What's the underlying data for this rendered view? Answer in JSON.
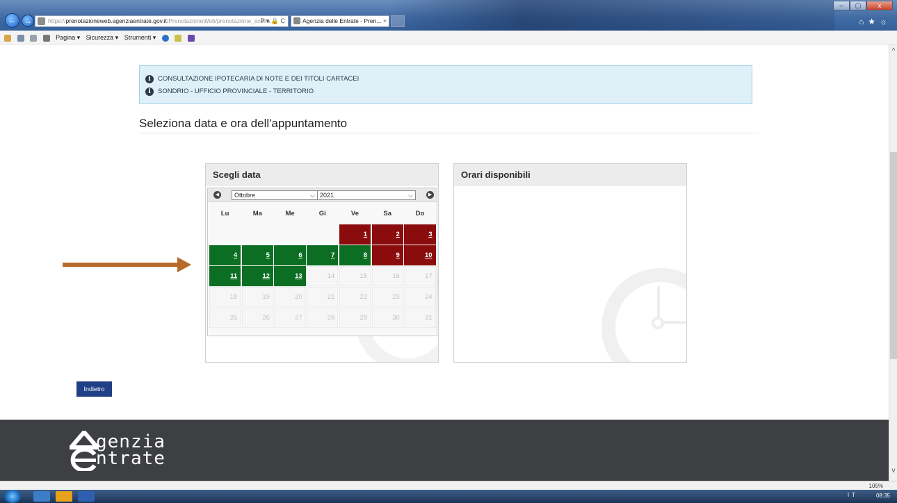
{
  "browser": {
    "address_prefix": "https://",
    "address_host": "prenotazioneweb.agenziaentrate.gov.it",
    "address_path": "/PrenotazioneWeb/prenotazione_scelta...",
    "address_controls": "P ▾ 🔒 C",
    "tab_title": "Agenzia delle Entrate - Pren...",
    "tab_close": "×",
    "commands": [
      "Pagina ▾",
      "Sicurezza ▾",
      "Strumenti ▾"
    ],
    "zoom": "105%",
    "window_controls": [
      "–",
      "▢",
      "x"
    ],
    "right_icons": "⌂★☼"
  },
  "info": {
    "lines": [
      "CONSULTAZIONE IPOTECARIA DI NOTE E DEI TITOLI CARTACEI",
      "SONDRIO - UFFICIO PROVINCIALE - TERRITORIO"
    ]
  },
  "page": {
    "title": "Seleziona data e ora dell'appuntamento",
    "back_label": "Indietro"
  },
  "date_panel": {
    "title": "Scegli data",
    "month": "Ottobre",
    "year": "2021",
    "weekdays": [
      "Lu",
      "Ma",
      "Me",
      "Gi",
      "Ve",
      "Sa",
      "Do"
    ],
    "weeks": [
      [
        {
          "d": "",
          "s": "empty"
        },
        {
          "d": "",
          "s": "empty"
        },
        {
          "d": "",
          "s": "empty"
        },
        {
          "d": "",
          "s": "empty"
        },
        {
          "d": "1",
          "s": "full"
        },
        {
          "d": "2",
          "s": "full"
        },
        {
          "d": "3",
          "s": "full"
        }
      ],
      [
        {
          "d": "4",
          "s": "avail"
        },
        {
          "d": "5",
          "s": "avail"
        },
        {
          "d": "6",
          "s": "avail"
        },
        {
          "d": "7",
          "s": "avail"
        },
        {
          "d": "8",
          "s": "avail"
        },
        {
          "d": "9",
          "s": "full"
        },
        {
          "d": "10",
          "s": "full"
        }
      ],
      [
        {
          "d": "11",
          "s": "avail"
        },
        {
          "d": "12",
          "s": "avail"
        },
        {
          "d": "13",
          "s": "avail"
        },
        {
          "d": "14",
          "s": "off"
        },
        {
          "d": "15",
          "s": "off"
        },
        {
          "d": "16",
          "s": "off"
        },
        {
          "d": "17",
          "s": "off"
        }
      ],
      [
        {
          "d": "18",
          "s": "off"
        },
        {
          "d": "19",
          "s": "off"
        },
        {
          "d": "20",
          "s": "off"
        },
        {
          "d": "21",
          "s": "off"
        },
        {
          "d": "22",
          "s": "off"
        },
        {
          "d": "23",
          "s": "off"
        },
        {
          "d": "24",
          "s": "off"
        }
      ],
      [
        {
          "d": "25",
          "s": "off"
        },
        {
          "d": "26",
          "s": "off"
        },
        {
          "d": "27",
          "s": "off"
        },
        {
          "d": "28",
          "s": "off"
        },
        {
          "d": "29",
          "s": "off"
        },
        {
          "d": "30",
          "s": "off"
        },
        {
          "d": "31",
          "s": "off"
        }
      ]
    ],
    "colors": {
      "available": "#0b6e22",
      "full": "#8a0c0c"
    }
  },
  "hours_panel": {
    "title": "Orari disponibili"
  },
  "footer": {
    "logo_line1": "genzia",
    "logo_line2": "ntrate"
  },
  "taskbar": {
    "tray": "IT",
    "clock": "08:35"
  },
  "icons": [
    "back-icon",
    "forward-icon",
    "info-icon",
    "calendar-prev-icon",
    "calendar-next-icon",
    "clock-watermark-icon",
    "arrow-icon"
  ]
}
